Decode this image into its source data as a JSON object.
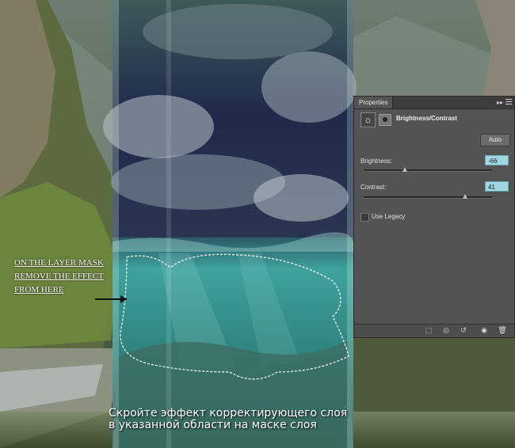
{
  "panel": {
    "tab_label": "Properties",
    "collapse_glyph": "▸▸",
    "title": "Brightness/Contrast",
    "adjustment_icon": "sun-icon",
    "mask_icon": "layer-mask-icon",
    "auto_label": "Auto",
    "brightness": {
      "label": "Brightness:",
      "value": "-66",
      "slider_fraction": 0.32
    },
    "contrast": {
      "label": "Contrast:",
      "value": "41",
      "slider_fraction": 0.79
    },
    "legacy_label": "Use Legacy",
    "legacy_checked": false,
    "footer_icons": [
      "clip-to-layer-icon",
      "view-previous-state-icon",
      "reset-icon",
      "visibility-eye-icon",
      "trash-icon"
    ]
  },
  "annotation": {
    "line1": "ON THE LAYER MASK",
    "line2": "REMOVE THE EFFECT",
    "line3": "FROM HERE"
  },
  "caption": {
    "line1": "Скройте эффект корректирующего слоя",
    "line2": "в указанной области на маске слоя"
  },
  "colors": {
    "panel_bg": "#535353",
    "value_field": "#a3d6e3",
    "water": "#2f8a86",
    "sky": "#1c2448"
  }
}
